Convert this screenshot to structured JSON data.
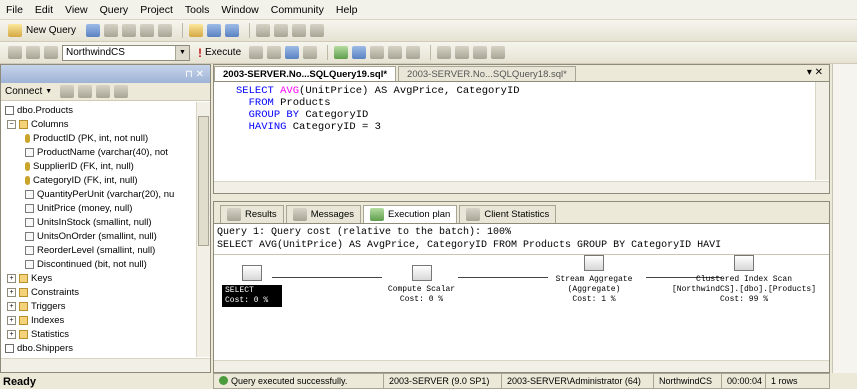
{
  "menu": [
    "File",
    "Edit",
    "View",
    "Query",
    "Project",
    "Tools",
    "Window",
    "Community",
    "Help"
  ],
  "toolbar": {
    "new_query": "New Query",
    "database": "NorthwindCS",
    "execute": "Execute"
  },
  "object_explorer": {
    "connect": "Connect",
    "tree": [
      {
        "label": "dbo.Products",
        "kind": "table",
        "level": 0
      },
      {
        "label": "Columns",
        "kind": "folder",
        "level": 1,
        "expanded": true
      },
      {
        "label": "ProductID (PK, int, not null)",
        "kind": "key",
        "level": 2
      },
      {
        "label": "ProductName (varchar(40), not",
        "kind": "column",
        "level": 2
      },
      {
        "label": "SupplierID (FK, int, null)",
        "kind": "key",
        "level": 2
      },
      {
        "label": "CategoryID (FK, int, null)",
        "kind": "key",
        "level": 2
      },
      {
        "label": "QuantityPerUnit (varchar(20), nu",
        "kind": "column",
        "level": 2
      },
      {
        "label": "UnitPrice (money, null)",
        "kind": "column",
        "level": 2
      },
      {
        "label": "UnitsInStock (smallint, null)",
        "kind": "column",
        "level": 2
      },
      {
        "label": "UnitsOnOrder (smallint, null)",
        "kind": "column",
        "level": 2
      },
      {
        "label": "ReorderLevel (smallint, null)",
        "kind": "column",
        "level": 2
      },
      {
        "label": "Discontinued (bit, not null)",
        "kind": "column",
        "level": 2
      },
      {
        "label": "Keys",
        "kind": "folder",
        "level": 1,
        "expanded": false
      },
      {
        "label": "Constraints",
        "kind": "folder",
        "level": 1,
        "expanded": false
      },
      {
        "label": "Triggers",
        "kind": "folder",
        "level": 1,
        "expanded": false
      },
      {
        "label": "Indexes",
        "kind": "folder",
        "level": 1,
        "expanded": false
      },
      {
        "label": "Statistics",
        "kind": "folder",
        "level": 1,
        "expanded": false
      },
      {
        "label": "dbo.Shippers",
        "kind": "table",
        "level": 0
      }
    ]
  },
  "editor": {
    "tabs": [
      "2003-SERVER.No...SQLQuery19.sql*",
      "2003-SERVER.No...SQLQuery18.sql*"
    ],
    "code": [
      {
        "kw": "SELECT",
        "fn": "AVG",
        "rest": "(UnitPrice) AS AvgPrice, CategoryID"
      },
      {
        "kw": "FROM",
        "rest": " Products"
      },
      {
        "kw": "GROUP BY",
        "rest": " CategoryID"
      },
      {
        "kw": "HAVING",
        "rest": " CategoryID = 3"
      }
    ]
  },
  "results": {
    "tabs": [
      "Results",
      "Messages",
      "Execution plan",
      "Client Statistics"
    ],
    "plan_line1": "Query 1: Query cost (relative to the batch): 100%",
    "plan_line2": "SELECT AVG(UnitPrice) AS AvgPrice, CategoryID FROM Products GROUP BY CategoryID HAVI",
    "ops": [
      {
        "name": "SELECT",
        "cost": "Cost: 0 %"
      },
      {
        "name": "Compute Scalar",
        "cost": "Cost: 0 %"
      },
      {
        "name": "Stream Aggregate",
        "sub": "(Aggregate)",
        "cost": "Cost: 1 %"
      },
      {
        "name": "Clustered Index Scan",
        "sub": "[NorthwindCS].[dbo].[Products]",
        "cost": "Cost: 99 %"
      }
    ]
  },
  "query_status": {
    "message": "Query executed successfully.",
    "server": "2003-SERVER (9.0 SP1)",
    "user": "2003-SERVER\\Administrator (64)",
    "database": "NorthwindCS",
    "time": "00:00:04",
    "rows": "1 rows"
  },
  "app_status": "Ready"
}
